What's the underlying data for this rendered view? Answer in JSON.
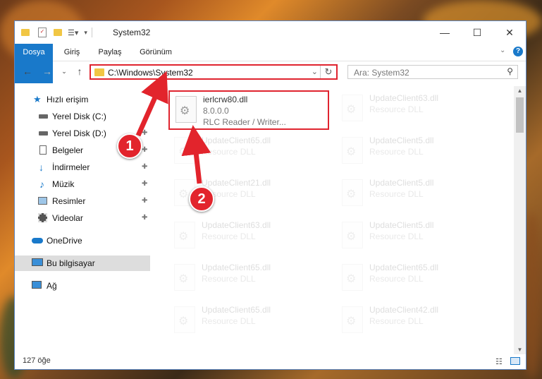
{
  "window": {
    "title": "System32"
  },
  "ribbon": {
    "tabs": [
      "Dosya",
      "Giriş",
      "Paylaş",
      "Görünüm"
    ]
  },
  "address": {
    "path": "C:\\Windows\\System32"
  },
  "search": {
    "placeholder": "Ara: System32"
  },
  "sidebar": {
    "items": [
      {
        "label": "Hızlı erişim",
        "icon": "star-icon"
      },
      {
        "label": "Yerel Disk (C:)",
        "icon": "drive-icon"
      },
      {
        "label": "Yerel Disk (D:)",
        "icon": "drive-icon"
      },
      {
        "label": "Belgeler",
        "icon": "documents-icon"
      },
      {
        "label": "İndirmeler",
        "icon": "download-icon"
      },
      {
        "label": "Müzik",
        "icon": "music-icon"
      },
      {
        "label": "Resimler",
        "icon": "pictures-icon"
      },
      {
        "label": "Videolar",
        "icon": "videos-icon"
      },
      {
        "label": "OneDrive",
        "icon": "cloud-icon"
      },
      {
        "label": "Bu bilgisayar",
        "icon": "computer-icon"
      },
      {
        "label": "Ağ",
        "icon": "network-icon"
      }
    ]
  },
  "files": [
    {
      "name": "ierlcrw80.dll",
      "version": "8.0.0.0",
      "desc": "RLC Reader / Writer..."
    },
    {
      "name": "UpdateClient63.dll",
      "desc": "Resource DLL"
    },
    {
      "name": "UpdateClient65.dll",
      "desc": "Resource DLL"
    },
    {
      "name": "UpdateClient5.dll",
      "desc": "Resource DLL"
    },
    {
      "name": "UpdateClient21.dll",
      "desc": "Resource DLL"
    },
    {
      "name": "UpdateClient5.dll",
      "desc": "Resource DLL"
    },
    {
      "name": "UpdateClient63.dll",
      "desc": "Resource DLL"
    },
    {
      "name": "UpdateClient5.dll",
      "desc": "Resource DLL"
    },
    {
      "name": "UpdateClient65.dll",
      "desc": "Resource DLL"
    },
    {
      "name": "UpdateClient65.dll",
      "desc": "Resource DLL"
    },
    {
      "name": "UpdateClient65.dll",
      "desc": "Resource DLL"
    },
    {
      "name": "UpdateClient42.dll",
      "desc": "Resource DLL"
    }
  ],
  "status": {
    "count": "127 öğe"
  },
  "annotations": {
    "step1": "1",
    "step2": "2"
  },
  "colors": {
    "accent": "#1979ca",
    "highlight": "#e0242f"
  }
}
